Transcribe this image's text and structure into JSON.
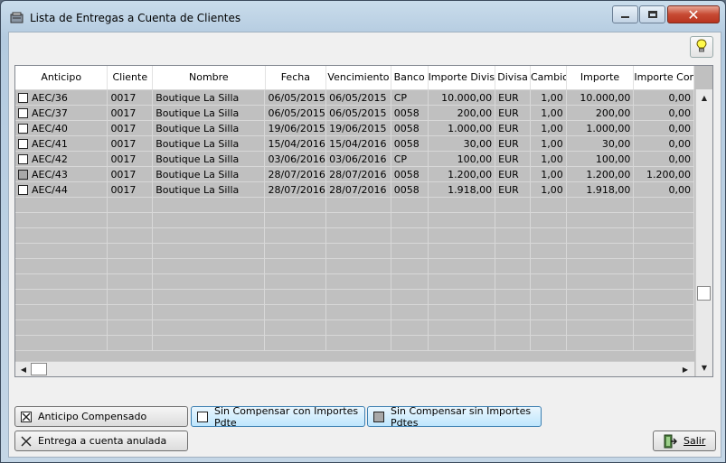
{
  "window": {
    "title": "Lista de Entregas a Cuenta de Clientes",
    "minimize_icon": "minimize-icon",
    "maximize_icon": "maximize-icon",
    "close_icon": "close-icon"
  },
  "toolbar": {
    "help_icon": "lightbulb-icon"
  },
  "table": {
    "columns": [
      "Anticipo",
      "Cliente",
      "Nombre",
      "Fecha",
      "Vencimiento",
      "Banco",
      "Importe Divisa",
      "Divisa",
      "Cambio",
      "Importe",
      "Importe Com"
    ],
    "rows": [
      {
        "checkbox": "empty",
        "anticipo": "AEC/36",
        "cliente": "0017",
        "nombre": "Boutique La Silla",
        "fecha": "06/05/2015",
        "vencimiento": "06/05/2015",
        "banco": "CP",
        "importe_divisa": "10.000,00",
        "divisa": "EUR",
        "cambio": "1,00",
        "importe": "10.000,00",
        "importe_com": "0,00"
      },
      {
        "checkbox": "empty",
        "anticipo": "AEC/37",
        "cliente": "0017",
        "nombre": "Boutique La Silla",
        "fecha": "06/05/2015",
        "vencimiento": "06/05/2015",
        "banco": "0058",
        "importe_divisa": "200,00",
        "divisa": "EUR",
        "cambio": "1,00",
        "importe": "200,00",
        "importe_com": "0,00"
      },
      {
        "checkbox": "empty",
        "anticipo": "AEC/40",
        "cliente": "0017",
        "nombre": "Boutique La Silla",
        "fecha": "19/06/2015",
        "vencimiento": "19/06/2015",
        "banco": "0058",
        "importe_divisa": "1.000,00",
        "divisa": "EUR",
        "cambio": "1,00",
        "importe": "1.000,00",
        "importe_com": "0,00"
      },
      {
        "checkbox": "empty",
        "anticipo": "AEC/41",
        "cliente": "0017",
        "nombre": "Boutique La Silla",
        "fecha": "15/04/2016",
        "vencimiento": "15/04/2016",
        "banco": "0058",
        "importe_divisa": "30,00",
        "divisa": "EUR",
        "cambio": "1,00",
        "importe": "30,00",
        "importe_com": "0,00"
      },
      {
        "checkbox": "empty",
        "anticipo": "AEC/42",
        "cliente": "0017",
        "nombre": "Boutique La Silla",
        "fecha": "03/06/2016",
        "vencimiento": "03/06/2016",
        "banco": "CP",
        "importe_divisa": "100,00",
        "divisa": "EUR",
        "cambio": "1,00",
        "importe": "100,00",
        "importe_com": "0,00"
      },
      {
        "checkbox": "grey",
        "anticipo": "AEC/43",
        "cliente": "0017",
        "nombre": "Boutique La Silla",
        "fecha": "28/07/2016",
        "vencimiento": "28/07/2016",
        "banco": "0058",
        "importe_divisa": "1.200,00",
        "divisa": "EUR",
        "cambio": "1,00",
        "importe": "1.200,00",
        "importe_com": "1.200,00"
      },
      {
        "checkbox": "empty",
        "anticipo": "AEC/44",
        "cliente": "0017",
        "nombre": "Boutique La Silla",
        "fecha": "28/07/2016",
        "vencimiento": "28/07/2016",
        "banco": "0058",
        "importe_divisa": "1.918,00",
        "divisa": "EUR",
        "cambio": "1,00",
        "importe": "1.918,00",
        "importe_com": "0,00"
      }
    ]
  },
  "legend": {
    "compensado": "Anticipo Compensado",
    "con_importes": "Sin Compensar con Importes  Pdte",
    "sin_importes": "Sin Compensar sin Importes  Pdtes",
    "anulada": "Entrega a cuenta anulada"
  },
  "footer": {
    "exit_label": "Salir"
  }
}
